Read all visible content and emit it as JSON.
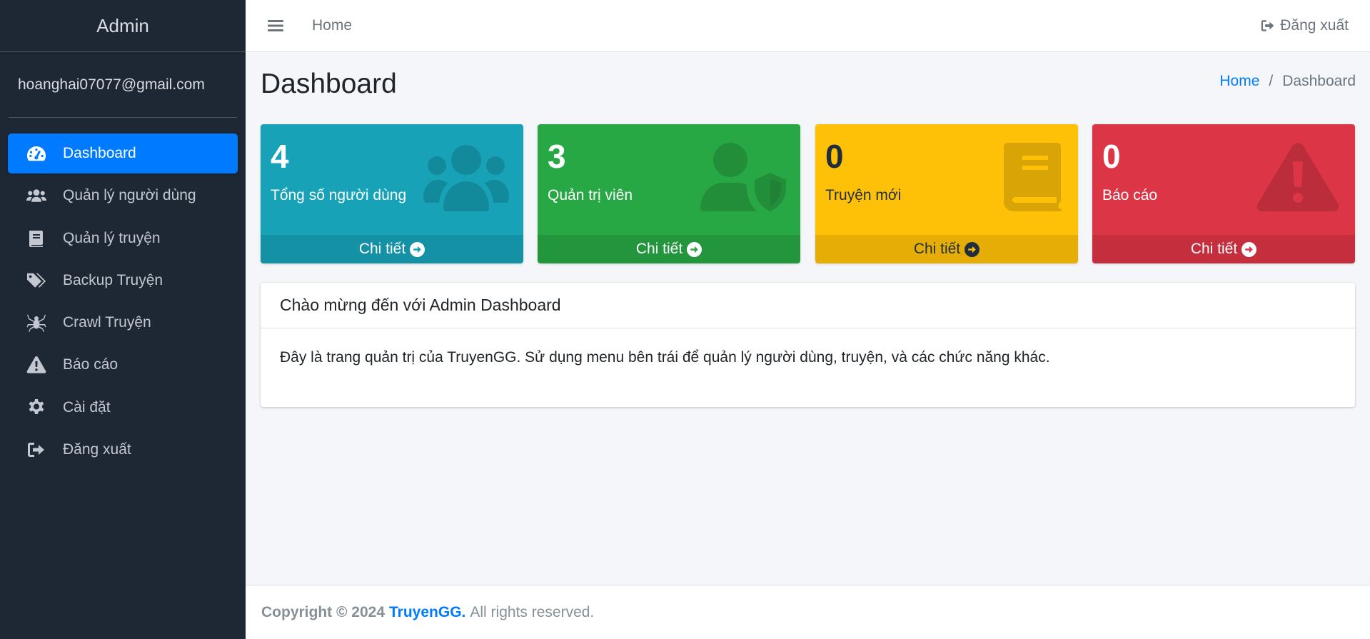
{
  "sidebar": {
    "brand": "Admin",
    "user_email": "hoanghai07077@gmail.com",
    "items": [
      {
        "label": "Dashboard",
        "icon": "tachometer-icon",
        "active": true
      },
      {
        "label": "Quản lý người dùng",
        "icon": "users-icon"
      },
      {
        "label": "Quản lý truyện",
        "icon": "book-icon"
      },
      {
        "label": "Backup Truyện",
        "icon": "tags-icon"
      },
      {
        "label": "Crawl Truyện",
        "icon": "spider-icon"
      },
      {
        "label": "Báo cáo",
        "icon": "warning-icon"
      },
      {
        "label": "Cài đặt",
        "icon": "gear-icon"
      },
      {
        "label": "Đăng xuất",
        "icon": "sign-out-icon"
      }
    ]
  },
  "topbar": {
    "menu_icon": "bars-icon",
    "home_label": "Home",
    "logout_label": "Đăng xuất",
    "logout_icon": "sign-out-icon"
  },
  "page": {
    "title": "Dashboard",
    "breadcrumb": {
      "home": "Home",
      "separator": "/",
      "current": "Dashboard"
    }
  },
  "stats": [
    {
      "value": "4",
      "label": "Tổng số người dùng",
      "footer": "Chi tiết",
      "color": "#17a2b8",
      "icon": "users-icon"
    },
    {
      "value": "3",
      "label": "Quản trị viên",
      "footer": "Chi tiết",
      "color": "#28a745",
      "icon": "user-shield-icon"
    },
    {
      "value": "0",
      "label": "Truyện mới",
      "footer": "Chi tiết",
      "color": "#ffc107",
      "icon": "book-icon"
    },
    {
      "value": "0",
      "label": "Báo cáo",
      "footer": "Chi tiết",
      "color": "#dc3545",
      "icon": "warning-icon"
    }
  ],
  "welcome_card": {
    "title": "Chào mừng đến với Admin Dashboard",
    "body": "Đây là trang quản trị của TruyenGG. Sử dụng menu bên trái để quản lý người dùng, truyện, và các chức năng khác."
  },
  "footer": {
    "copyright": "Copyright © 2024",
    "brand": "TruyenGG.",
    "rest": "All rights reserved."
  },
  "colors": {
    "sidebar_bg": "#1e2834",
    "active": "#007bff",
    "link": "#007bff"
  }
}
